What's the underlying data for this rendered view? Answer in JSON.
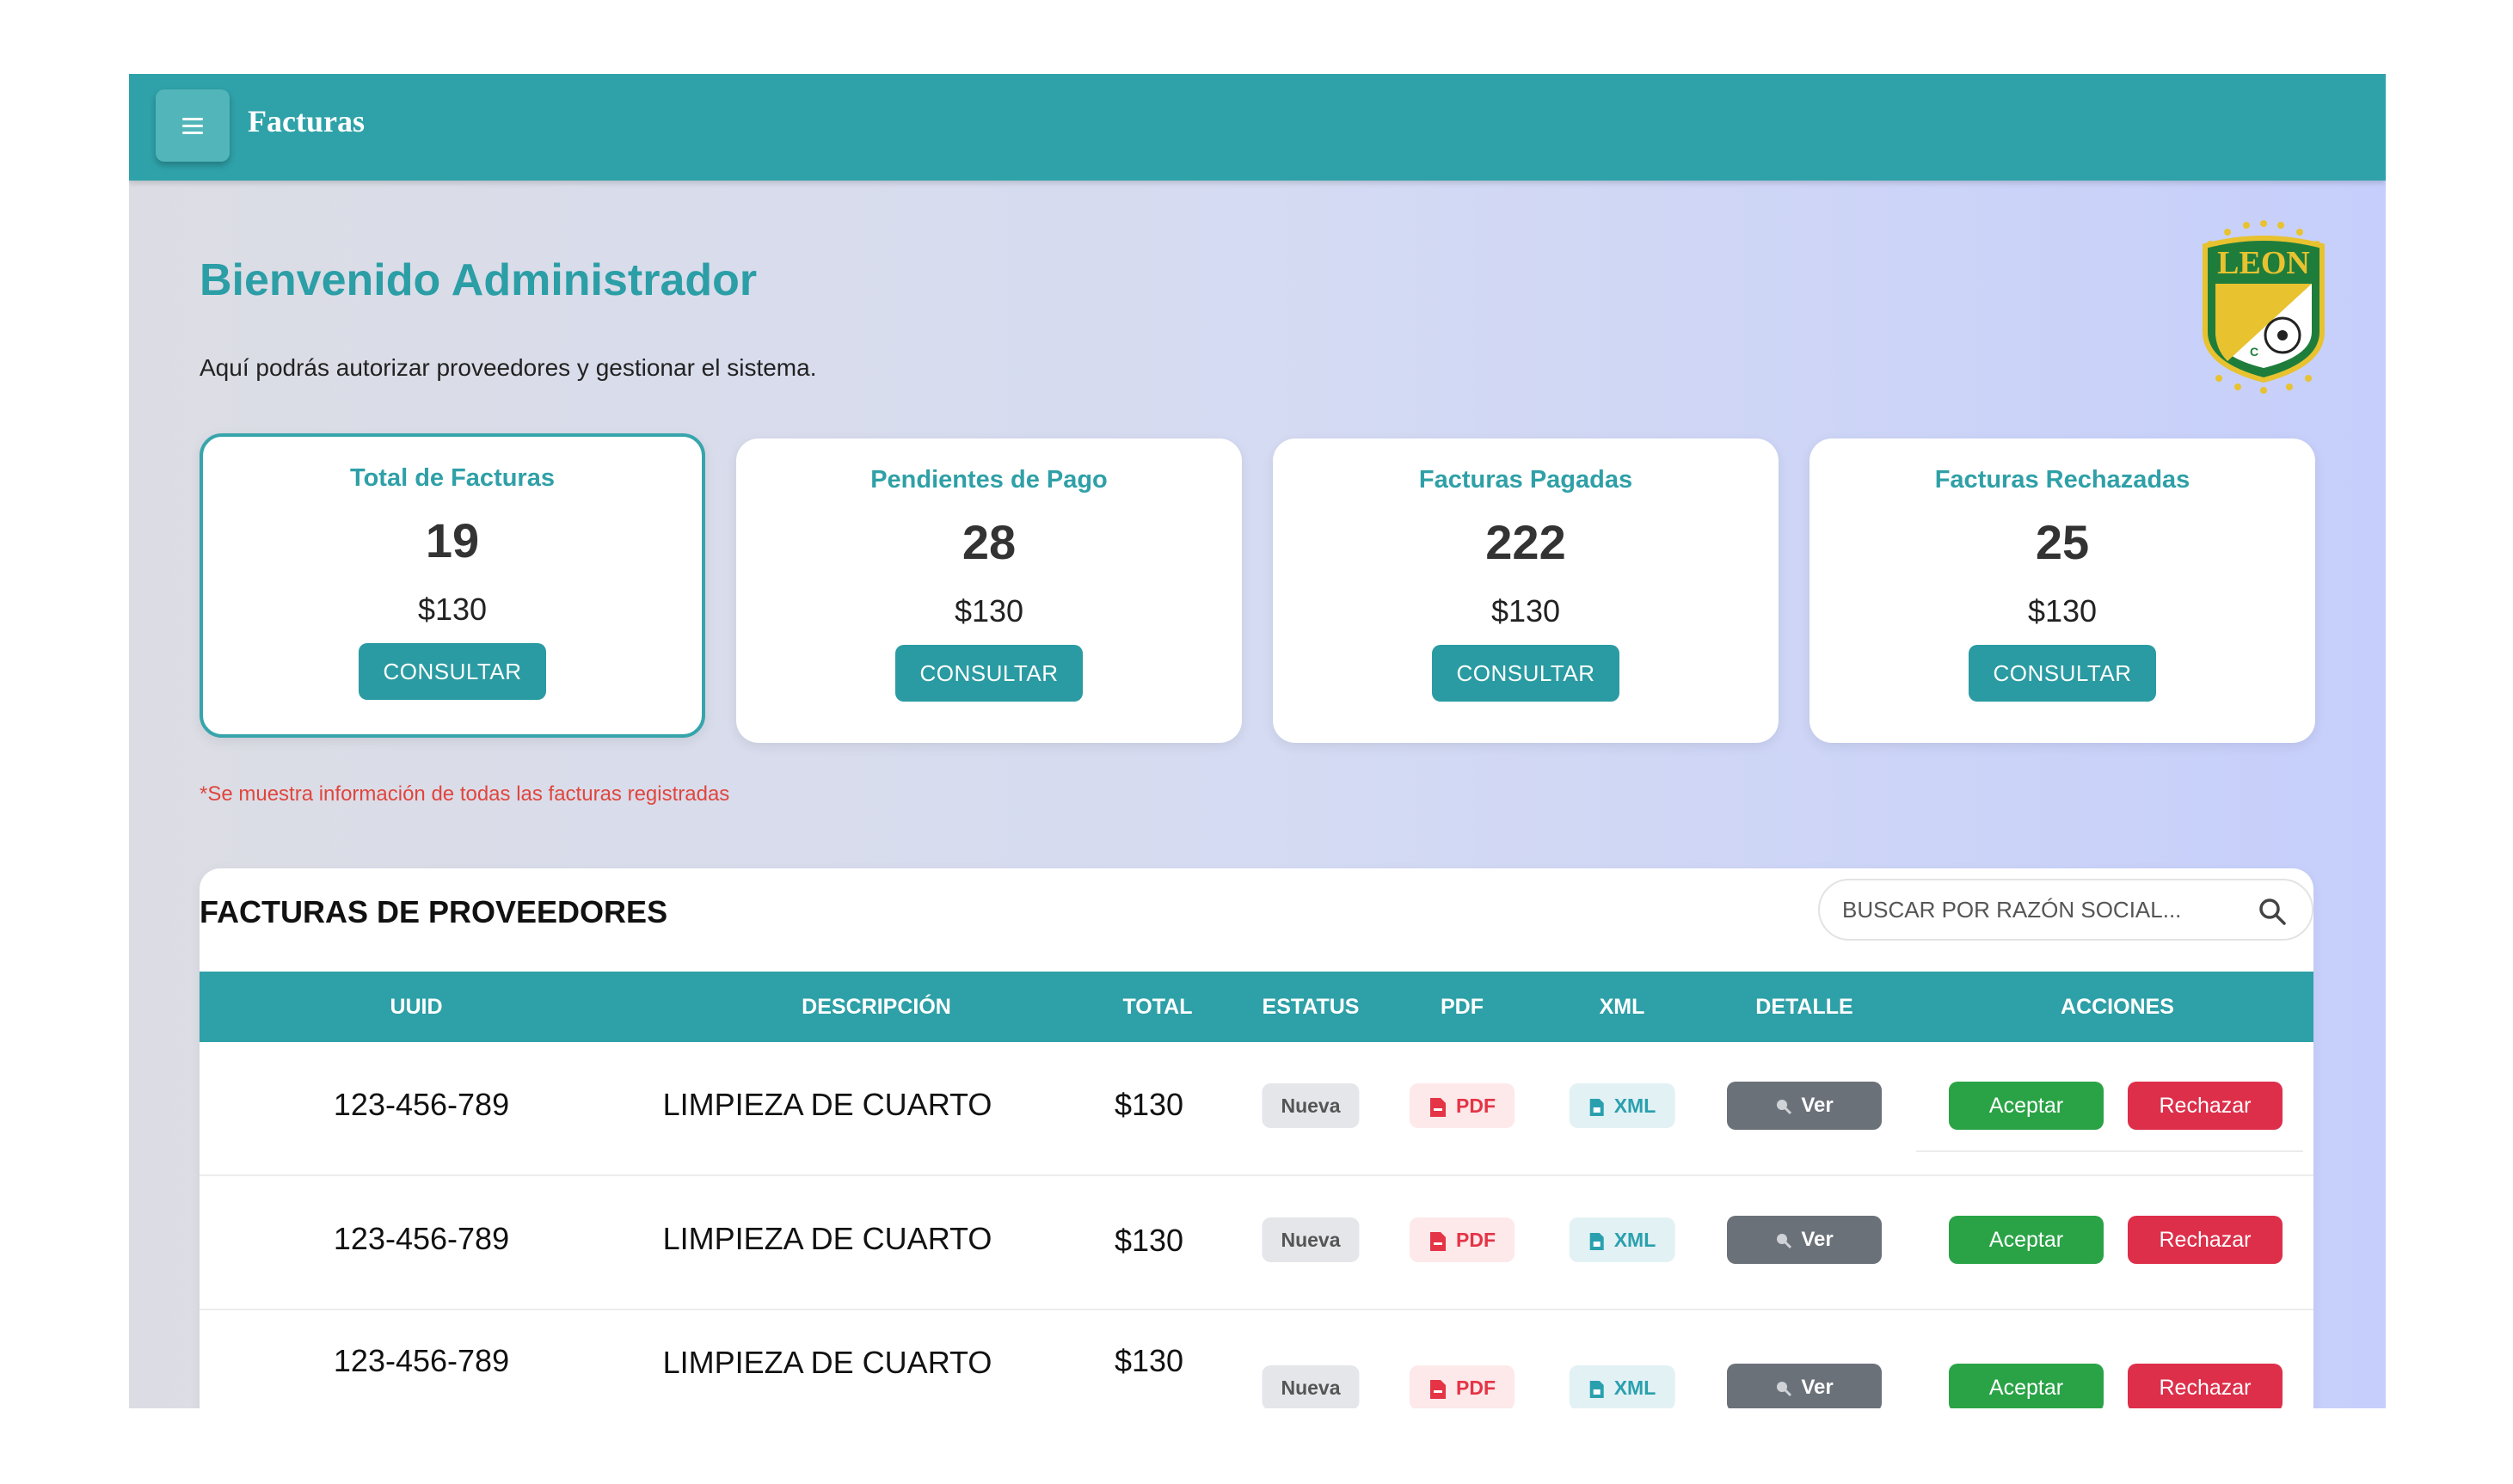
{
  "header": {
    "title": "Facturas",
    "menu_icon": "hamburger-icon"
  },
  "welcome": {
    "title": "Bienvenido Administrador",
    "subtitle": "Aquí podrás autorizar proveedores y gestionar el sistema."
  },
  "logo": {
    "text": "LEON",
    "letter": "C",
    "icon": "club-leon-crest"
  },
  "cards": [
    {
      "title": "Total de Facturas",
      "count": "19",
      "amount": "$130",
      "button": "CONSULTAR"
    },
    {
      "title": "Pendientes de Pago",
      "count": "28",
      "amount": "$130",
      "button": "CONSULTAR"
    },
    {
      "title": "Facturas Pagadas",
      "count": "222",
      "amount": "$130",
      "button": "CONSULTAR"
    },
    {
      "title": "Facturas Rechazadas",
      "count": "25",
      "amount": "$130",
      "button": "CONSULTAR"
    }
  ],
  "note": "*Se muestra información de todas las facturas registradas",
  "table": {
    "title": "FACTURAS DE PROVEEDORES",
    "search_placeholder": "BUSCAR POR RAZÓN SOCIAL...",
    "columns": [
      "UUID",
      "DESCRIPCIÓN",
      "TOTAL",
      "ESTATUS",
      "PDF",
      "XML",
      "DETALLE",
      "ACCIONES"
    ],
    "rows": [
      {
        "uuid": "123-456-789",
        "descripcion": "LIMPIEZA DE CUARTO",
        "total": "$130",
        "estatus": "Nueva",
        "pdf": "PDF",
        "xml": "XML",
        "detalle": "Ver",
        "aceptar": "Aceptar",
        "rechazar": "Rechazar"
      },
      {
        "uuid": "123-456-789",
        "descripcion": "LIMPIEZA DE CUARTO",
        "total": "$130",
        "estatus": "Nueva",
        "pdf": "PDF",
        "xml": "XML",
        "detalle": "Ver",
        "aceptar": "Aceptar",
        "rechazar": "Rechazar"
      },
      {
        "uuid": "123-456-789",
        "descripcion": "LIMPIEZA DE CUARTO",
        "total": "$130",
        "estatus": "Nueva",
        "pdf": "PDF",
        "xml": "XML",
        "detalle": "Ver",
        "aceptar": "Aceptar",
        "rechazar": "Rechazar"
      }
    ]
  },
  "colors": {
    "primary": "#2fa2a9",
    "accept": "#2aa346",
    "reject": "#dd2f4a",
    "detail": "#6b7179",
    "note": "#e0453d"
  }
}
